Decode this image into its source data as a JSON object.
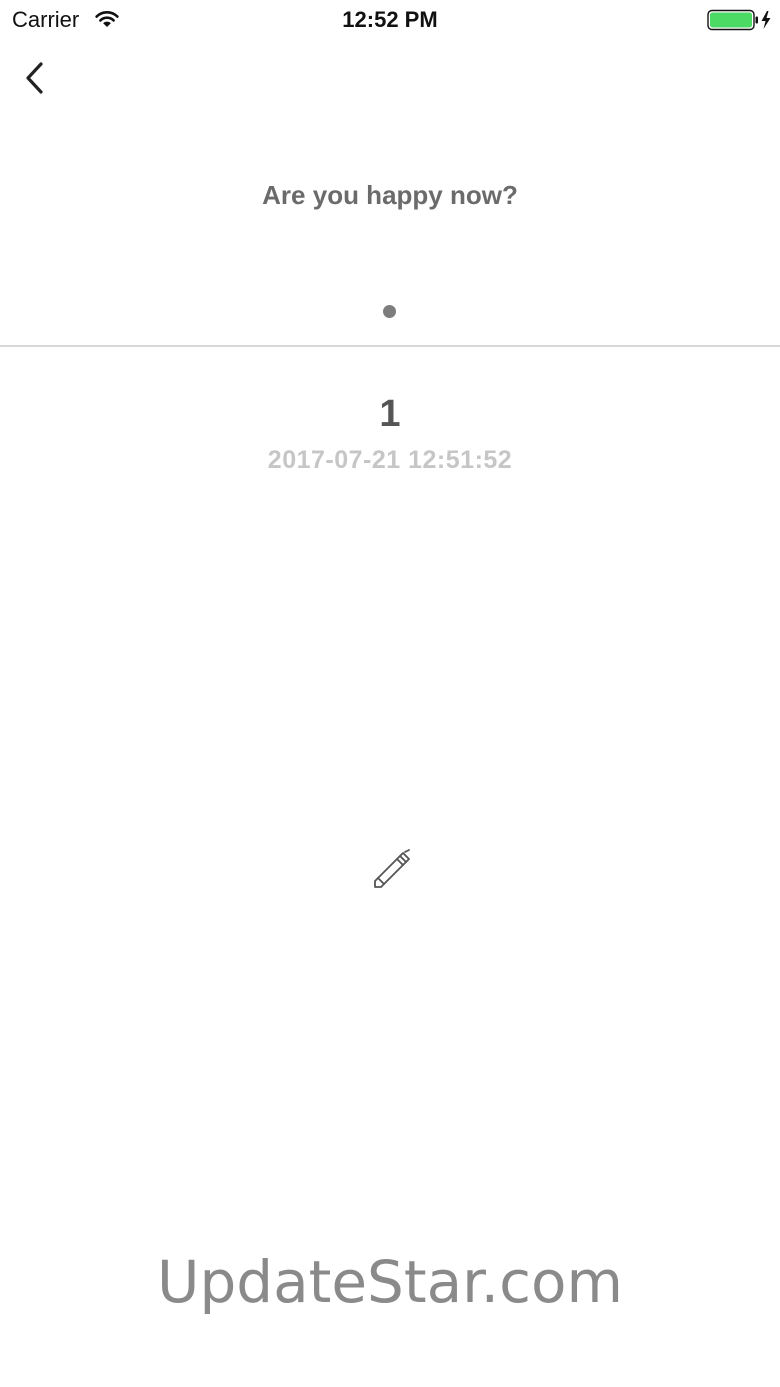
{
  "status_bar": {
    "carrier": "Carrier",
    "time": "12:52 PM",
    "wifi_icon": "wifi-icon",
    "battery_icon": "battery-charging-icon",
    "battery_color": "#4cd964"
  },
  "nav": {
    "back_icon": "chevron-left-icon"
  },
  "main": {
    "question": "Are you happy now?",
    "page_indicator_count": 1,
    "entry": {
      "number": "1",
      "timestamp": "2017-07-21 12:51:52"
    },
    "edit_icon": "pen-icon"
  },
  "watermark": {
    "text": "UpdateStar.com"
  },
  "colors": {
    "question": "#6b6b6b",
    "number": "#555555",
    "timestamp": "#c6c6c6",
    "divider": "#d9d9d9",
    "dot": "#7d7d7d",
    "watermark": "#8a8a8a"
  }
}
